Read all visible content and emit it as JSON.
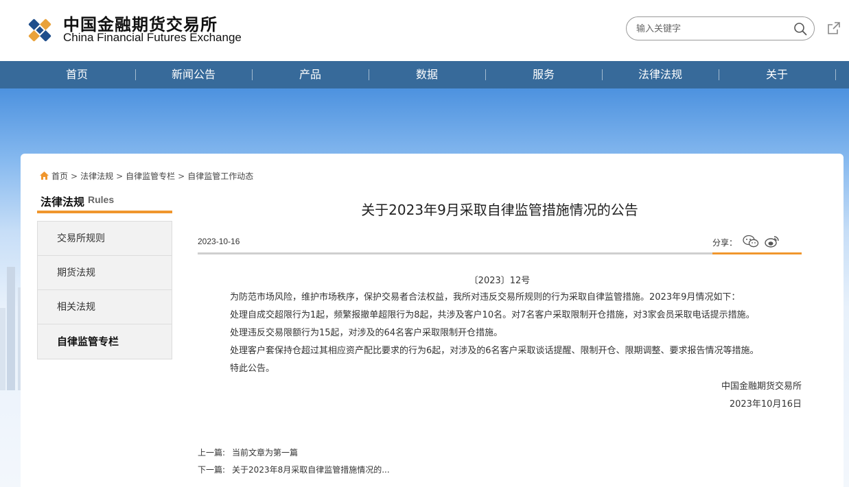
{
  "header": {
    "brand_cn": "中国金融期货交易所",
    "brand_en": "China Financial Futures Exchange",
    "search_placeholder": "输入关键字"
  },
  "nav": {
    "items": [
      "首页",
      "新闻公告",
      "产品",
      "数据",
      "服务",
      "法律法规",
      "关于"
    ]
  },
  "breadcrumb": {
    "items": [
      "首页",
      "法律法规",
      "自律监管专栏",
      "自律监管工作动态"
    ]
  },
  "sidebar": {
    "title": "法律法规",
    "title_en": "Rules",
    "items": [
      "交易所规则",
      "期货法规",
      "相关法规",
      "自律监管专栏"
    ]
  },
  "article": {
    "title": "关于2023年9月采取自律监管措施情况的公告",
    "date": "2023-10-16",
    "share_label": "分享：",
    "doc_no": "〔2023〕12号",
    "paragraphs": [
      "为防范市场风险，维护市场秩序，保护交易者合法权益，我所对违反交易所规则的行为采取自律监管措施。2023年9月情况如下：",
      "处理自成交超限行为1起，频繁报撤单超限行为8起，共涉及客户10名。对7名客户采取限制开仓措施，对3家会员采取电话提示措施。",
      "处理违反交易限额行为15起，对涉及的64名客户采取限制开仓措施。",
      "处理客户套保持仓超过其相应资产配比要求的行为6起，对涉及的6名客户采取谈话提醒、限制开仓、限期调整、要求报告情况等措施。",
      "特此公告。"
    ],
    "signature": "中国金融期货交易所",
    "sign_date": "2023年10月16日"
  },
  "prevnext": {
    "prev_label": "上一篇:",
    "prev_text": "当前文章为第一篇",
    "next_label": "下一篇:",
    "next_text": "关于2023年8月采取自律监管措施情况的..."
  },
  "colors": {
    "nav_bg": "#376a9a",
    "accent_orange": "#f0962d"
  }
}
